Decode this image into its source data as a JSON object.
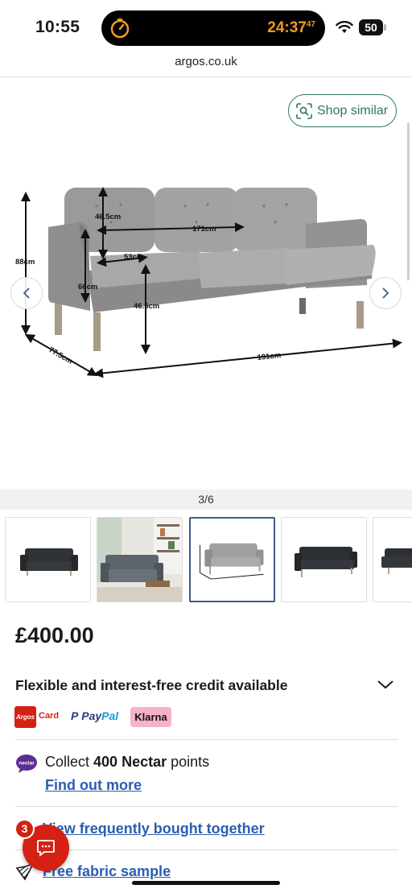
{
  "status_bar": {
    "time": "10:55",
    "timer": "24:37",
    "timer_sup": "47",
    "battery": "50",
    "timer_color": "#f39a1d"
  },
  "browser": {
    "url": "argos.co.uk"
  },
  "gallery": {
    "shop_similar_label": "Shop similar",
    "counter": "3/6",
    "dimensions": {
      "back_height": "46.5cm",
      "width_inner": "171cm",
      "height": "88cm",
      "seat_depth": "53cm",
      "arm_height": "66cm",
      "seat_height": "46.5cm",
      "depth": "77.5cm",
      "width": "191cm"
    }
  },
  "product": {
    "price": "£400.00",
    "credit_text": "Flexible and interest-free credit available",
    "payment_options": {
      "argos": "Argos",
      "card": "Card",
      "paypal_pay": "Pay",
      "paypal_pal": "Pal",
      "klarna": "Klarna"
    },
    "nectar": {
      "logo": "nectar",
      "prefix": "Collect ",
      "points": "400 Nectar",
      "suffix": " points",
      "link": "Find out more"
    },
    "bought_together_link": "View frequently bought together",
    "fabric_sample_link": "Free fabric sample"
  },
  "chat": {
    "badge_count": "3"
  },
  "colors": {
    "accent_green": "#2c7a57",
    "argos_red": "#d42114",
    "link_blue": "#2a5db0",
    "klarna_pink": "#f5b2c9"
  }
}
